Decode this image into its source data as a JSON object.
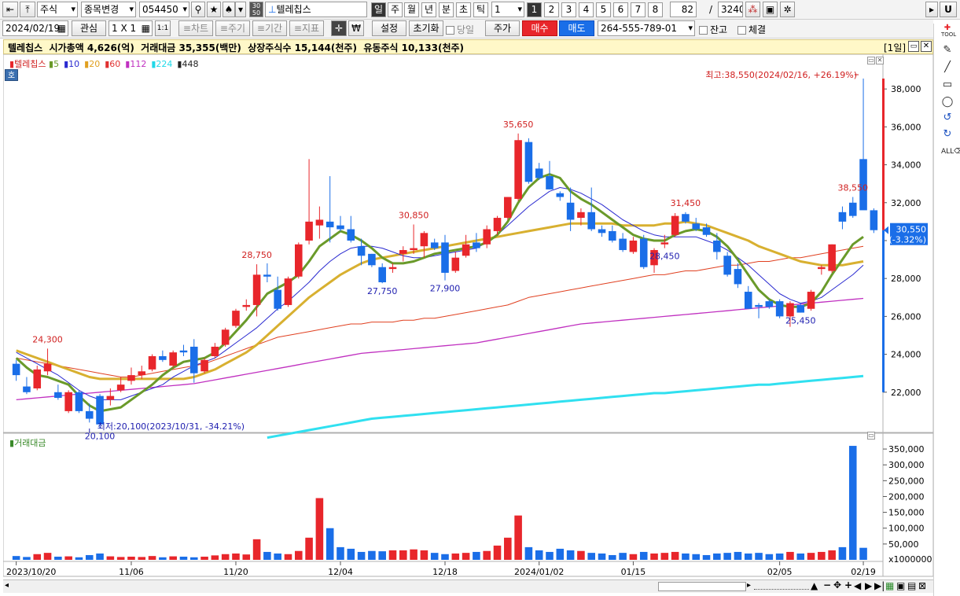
{
  "toolbar1": {
    "market": "주식",
    "change_item": "종목변경",
    "code": "054450",
    "chart_icon_top": "30",
    "chart_icon_bottom": "50",
    "stock_name": "텔레칩스",
    "periods": [
      "일",
      "주",
      "월",
      "년",
      "분",
      "초",
      "틱"
    ],
    "period_count": "1",
    "num_buttons": [
      "1",
      "2",
      "3",
      "4",
      "5",
      "6",
      "7",
      "8"
    ],
    "view_count": "82",
    "separator": "/",
    "total_count": "3240",
    "right_u": "U"
  },
  "toolbar2": {
    "date": "2024/02/19",
    "interest": "관심",
    "layout": "1 X 1",
    "one_one": "1:1",
    "tabs": [
      "≡차트",
      "≡주기",
      "≡기간",
      "≡지표"
    ],
    "currency_symbol": "₩",
    "settings": "설정",
    "reset": "초기화",
    "same_day": "당일",
    "price": "주가",
    "buy": "매수",
    "sell": "매도",
    "account": "264-555-789-01",
    "balance": "잔고",
    "executed": "체결"
  },
  "info_bar": {
    "text": "텔레칩스  시가총액 4,626(억)  거래대금 35,355(백만)  상장주식수 15,144(천주)  유동주식 10,133(천주)",
    "period_tag": "[1일]"
  },
  "legend": {
    "name": "텔레칩스",
    "items": [
      {
        "label": "5",
        "color": "#6a9a2a"
      },
      {
        "label": "10",
        "color": "#2a2ad0"
      },
      {
        "label": "20",
        "color": "#e0a020"
      },
      {
        "label": "60",
        "color": "#e03030"
      },
      {
        "label": "112",
        "color": "#c030c0"
      },
      {
        "label": "224",
        "color": "#20d8e8"
      },
      {
        "label": "448",
        "color": "#222222"
      }
    ],
    "badge": "호"
  },
  "annotations": {
    "max": "최고:38,550(2024/02/16, +26.19%)",
    "min": "최저:20,100(2023/10/31, -34.21%)",
    "current_price": "30,550",
    "current_change": "(-3.32%)",
    "peaks": [
      {
        "label": "24,300",
        "color": "#d02020",
        "idx": 3,
        "pos": "high"
      },
      {
        "label": "20,100",
        "color": "#2020b0",
        "idx": 8,
        "pos": "low"
      },
      {
        "label": "28,750",
        "color": "#d02020",
        "idx": 23,
        "pos": "high"
      },
      {
        "label": "27,750",
        "color": "#2020b0",
        "idx": 35,
        "pos": "low"
      },
      {
        "label": "30,850",
        "color": "#d02020",
        "idx": 38,
        "pos": "high"
      },
      {
        "label": "27,900",
        "color": "#2020b0",
        "idx": 41,
        "pos": "low"
      },
      {
        "label": "35,650",
        "color": "#d02020",
        "idx": 48,
        "pos": "high"
      },
      {
        "label": "31,450",
        "color": "#d02020",
        "idx": 64,
        "pos": "high"
      },
      {
        "label": "28,450",
        "color": "#2020b0",
        "idx": 62,
        "pos": "low"
      },
      {
        "label": "25,450",
        "color": "#2020b0",
        "idx": 75,
        "pos": "low"
      },
      {
        "label": "38,550",
        "color": "#d02020",
        "idx": 80,
        "pos": "high"
      }
    ]
  },
  "volume_panel": {
    "title": "거래대금",
    "unit": "x1000000"
  },
  "colors": {
    "up": "#e8262b",
    "down": "#1a6ee8",
    "ma5": "#6a9a2a",
    "ma10": "#2a2ad0",
    "ma20": "#d8b030",
    "ma60": "#e04020",
    "ma112": "#c030c0",
    "ma224": "#30e0f0"
  },
  "chart_data": {
    "type": "candlestick",
    "price_axis": {
      "ticks": [
        "38,000",
        "36,000",
        "34,000",
        "32,000",
        "30,000",
        "28,000",
        "26,000",
        "24,000",
        "22,000"
      ],
      "ylim": [
        20000,
        39500
      ]
    },
    "volume_axis": {
      "ticks": [
        "350,000",
        "300,000",
        "250,000",
        "200,000",
        "150,000",
        "100,000",
        "50,000"
      ],
      "ylim": [
        0,
        380000
      ]
    },
    "x_labels": [
      {
        "label": "2023/10/20",
        "idx": 0
      },
      {
        "label": "11/06",
        "idx": 11
      },
      {
        "label": "11/20",
        "idx": 21
      },
      {
        "label": "12/04",
        "idx": 31
      },
      {
        "label": "12/18",
        "idx": 41
      },
      {
        "label": "2024/01/02",
        "idx": 50
      },
      {
        "label": "01/15",
        "idx": 59
      },
      {
        "label": "02/05",
        "idx": 73
      },
      {
        "label": "02/19",
        "idx": 81
      }
    ],
    "candles": [
      [
        23500,
        23700,
        22600,
        22900
      ],
      [
        22300,
        22800,
        21900,
        22000
      ],
      [
        22200,
        23400,
        22100,
        23200
      ],
      [
        23100,
        24300,
        22900,
        23500
      ],
      [
        22000,
        22400,
        21600,
        21700
      ],
      [
        21000,
        22100,
        20900,
        22000
      ],
      [
        22000,
        22100,
        20900,
        21000
      ],
      [
        21000,
        21400,
        20400,
        20600
      ],
      [
        21800,
        21900,
        20100,
        20300
      ],
      [
        21600,
        22200,
        21300,
        21800
      ],
      [
        22100,
        22800,
        22000,
        22400
      ],
      [
        22600,
        23300,
        22400,
        22900
      ],
      [
        22900,
        23400,
        22700,
        23100
      ],
      [
        23200,
        24000,
        23100,
        23900
      ],
      [
        23900,
        24200,
        23600,
        23700
      ],
      [
        23400,
        24200,
        23300,
        24100
      ],
      [
        24200,
        24500,
        23900,
        24100
      ],
      [
        24400,
        24800,
        22500,
        23000
      ],
      [
        23100,
        23800,
        23000,
        23700
      ],
      [
        23900,
        24600,
        23800,
        24400
      ],
      [
        24500,
        25400,
        24400,
        25300
      ],
      [
        25500,
        26400,
        25400,
        26300
      ],
      [
        26500,
        26900,
        26300,
        26600
      ],
      [
        26600,
        28750,
        26000,
        28200
      ],
      [
        28200,
        28800,
        27800,
        28100
      ],
      [
        27400,
        28100,
        26300,
        26400
      ],
      [
        26600,
        28100,
        26500,
        28000
      ],
      [
        28100,
        29900,
        28000,
        29800
      ],
      [
        30000,
        34300,
        29800,
        31000
      ],
      [
        30800,
        31800,
        30100,
        31100
      ],
      [
        31000,
        33400,
        29900,
        30700
      ],
      [
        30800,
        31300,
        30500,
        30600
      ],
      [
        30600,
        31300,
        29900,
        30000
      ],
      [
        29700,
        30100,
        28700,
        29200
      ],
      [
        29300,
        29300,
        28600,
        28700
      ],
      [
        28600,
        28800,
        27750,
        27800
      ],
      [
        28500,
        28800,
        28300,
        28600
      ],
      [
        29300,
        29700,
        28900,
        29500
      ],
      [
        29500,
        30850,
        29300,
        29600
      ],
      [
        29700,
        30500,
        29100,
        30400
      ],
      [
        29900,
        30100,
        29500,
        29600
      ],
      [
        29900,
        30300,
        27900,
        28300
      ],
      [
        28400,
        29400,
        28300,
        29100
      ],
      [
        29200,
        30300,
        29100,
        29800
      ],
      [
        29900,
        30400,
        29400,
        29600
      ],
      [
        29800,
        30800,
        29600,
        30600
      ],
      [
        30500,
        31300,
        30300,
        31200
      ],
      [
        31200,
        32300,
        31100,
        32300
      ],
      [
        32200,
        35650,
        32100,
        35300
      ],
      [
        35200,
        35400,
        33000,
        33100
      ],
      [
        33800,
        34100,
        33200,
        33300
      ],
      [
        33400,
        34200,
        32700,
        32700
      ],
      [
        32500,
        32600,
        32100,
        32300
      ],
      [
        32000,
        32800,
        30500,
        31100
      ],
      [
        31200,
        31700,
        30800,
        31500
      ],
      [
        31500,
        32800,
        30500,
        30600
      ],
      [
        30600,
        30800,
        30200,
        30400
      ],
      [
        30500,
        30800,
        29900,
        30000
      ],
      [
        30100,
        30400,
        29400,
        29500
      ],
      [
        29400,
        30200,
        29300,
        30000
      ],
      [
        30100,
        30300,
        28500,
        28600
      ],
      [
        28700,
        29600,
        28300,
        29500
      ],
      [
        29800,
        30300,
        29600,
        29900
      ],
      [
        30300,
        31450,
        30200,
        31300
      ],
      [
        31400,
        31500,
        30900,
        31000
      ],
      [
        30900,
        31200,
        30500,
        30600
      ],
      [
        30700,
        30900,
        30200,
        30300
      ],
      [
        30000,
        30400,
        29000,
        29400
      ],
      [
        29200,
        29400,
        28100,
        28200
      ],
      [
        28500,
        28800,
        27500,
        27700
      ],
      [
        27300,
        27600,
        26400,
        26400
      ],
      [
        26600,
        26700,
        25900,
        26500
      ],
      [
        26800,
        26900,
        26400,
        26500
      ],
      [
        26800,
        26900,
        25900,
        26000
      ],
      [
        26000,
        26800,
        25450,
        26700
      ],
      [
        26600,
        26700,
        26200,
        26200
      ],
      [
        26400,
        27400,
        26300,
        27300
      ],
      [
        28500,
        28700,
        28200,
        28600
      ],
      [
        28400,
        29800,
        28300,
        29800
      ],
      [
        31500,
        31800,
        30600,
        31000
      ],
      [
        32000,
        32300,
        31200,
        31300
      ],
      [
        34300,
        38550,
        31700,
        31600
      ],
      [
        31600,
        31700,
        30400,
        30550
      ]
    ],
    "volume": [
      12000,
      9000,
      18000,
      22000,
      10000,
      11000,
      8000,
      15000,
      20000,
      11000,
      9000,
      10000,
      9000,
      12000,
      8000,
      11000,
      10000,
      8000,
      10000,
      14000,
      18000,
      20000,
      17000,
      65000,
      25000,
      20000,
      18000,
      28000,
      70000,
      195000,
      100000,
      40000,
      35000,
      25000,
      28000,
      27000,
      30000,
      30000,
      33000,
      30000,
      22000,
      18000,
      20000,
      22000,
      25000,
      28000,
      45000,
      70000,
      140000,
      40000,
      30000,
      25000,
      35000,
      30000,
      28000,
      22000,
      20000,
      15000,
      22000,
      18000,
      25000,
      20000,
      22000,
      25000,
      20000,
      18000,
      15000,
      20000,
      22000,
      25000,
      20000,
      22000,
      18000,
      20000,
      25000,
      20000,
      22000,
      25000,
      30000,
      40000,
      360000,
      38000
    ],
    "ma_lines": {
      "ma5": [
        23800,
        23300,
        22900,
        22800,
        22600,
        22400,
        21800,
        21300,
        21000,
        21100,
        21200,
        21600,
        22000,
        22400,
        22900,
        23300,
        23600,
        23700,
        23800,
        24100,
        24600,
        25200,
        25800,
        26500,
        27200,
        27500,
        27800,
        28200,
        28900,
        29700,
        30100,
        30500,
        30300,
        30000,
        29600,
        29100,
        28800,
        28800,
        28900,
        29100,
        29300,
        29400,
        29500,
        29600,
        29700,
        29900,
        30300,
        31000,
        32000,
        32800,
        33300,
        33500,
        33300,
        32600,
        32200,
        31900,
        31500,
        31100,
        30700,
        30300,
        30100,
        30000,
        30000,
        30300,
        30500,
        30600,
        30500,
        30200,
        29700,
        29000,
        28200,
        27400,
        26900,
        26600,
        26500,
        26500,
        26700,
        27300,
        28200,
        29000,
        29800,
        30200
      ],
      "ma10": [
        24100,
        23800,
        23500,
        23200,
        22900,
        22500,
        22100,
        21800,
        21600,
        21600,
        21600,
        21800,
        22000,
        22200,
        22400,
        22800,
        23100,
        23400,
        23600,
        23800,
        24200,
        24600,
        25000,
        25400,
        25900,
        26400,
        26800,
        27300,
        27800,
        28400,
        28900,
        29300,
        29600,
        29700,
        29700,
        29600,
        29400,
        29200,
        29100,
        29100,
        29200,
        29300,
        29400,
        29500,
        29600,
        29900,
        30300,
        30800,
        31300,
        31800,
        32200,
        32600,
        32800,
        32700,
        32500,
        32200,
        31900,
        31500,
        31100,
        30800,
        30500,
        30300,
        30200,
        30200,
        30200,
        30200,
        30000,
        29800,
        29500,
        29100,
        28700,
        28200,
        27700,
        27200,
        26900,
        26700,
        26800,
        27000,
        27400,
        27800,
        28200,
        28700
      ],
      "ma20": [
        24200,
        24000,
        23800,
        23600,
        23400,
        23200,
        23000,
        22800,
        22700,
        22700,
        22700,
        22700,
        22700,
        22700,
        22700,
        22700,
        22700,
        22800,
        23000,
        23200,
        23500,
        23800,
        24100,
        24500,
        25000,
        25500,
        26000,
        26500,
        27000,
        27400,
        27800,
        28200,
        28500,
        28800,
        29000,
        29100,
        29200,
        29300,
        29400,
        29500,
        29600,
        29700,
        29800,
        29900,
        30000,
        30100,
        30200,
        30300,
        30400,
        30500,
        30600,
        30700,
        30800,
        30900,
        30900,
        30900,
        30900,
        30900,
        30800,
        30800,
        30800,
        30800,
        30900,
        30900,
        31000,
        30900,
        30800,
        30600,
        30400,
        30200,
        30000,
        29700,
        29500,
        29300,
        29100,
        28900,
        28800,
        28700,
        28700,
        28700,
        28800,
        28900
      ],
      "ma60": [
        23800,
        23700,
        23600,
        23500,
        23400,
        23300,
        23200,
        23100,
        23000,
        22900,
        22800,
        22800,
        22900,
        23000,
        23100,
        23200,
        23300,
        23400,
        23500,
        23700,
        23900,
        24100,
        24300,
        24500,
        24700,
        24900,
        25000,
        25100,
        25200,
        25300,
        25400,
        25500,
        25600,
        25600,
        25700,
        25700,
        25700,
        25800,
        25800,
        25900,
        25900,
        26000,
        26100,
        26200,
        26300,
        26400,
        26500,
        26600,
        26800,
        27000,
        27100,
        27200,
        27300,
        27400,
        27500,
        27600,
        27700,
        27800,
        27900,
        28000,
        28100,
        28200,
        28200,
        28300,
        28400,
        28400,
        28500,
        28600,
        28700,
        28700,
        28800,
        28900,
        28900,
        29000,
        29100,
        29100,
        29200,
        29300,
        29400,
        29500,
        29600,
        29700
      ],
      "ma112": [
        21600,
        21650,
        21700,
        21750,
        21800,
        21850,
        21900,
        21950,
        22000,
        22050,
        22100,
        22150,
        22200,
        22250,
        22300,
        22350,
        22400,
        22450,
        22550,
        22650,
        22750,
        22850,
        22950,
        23050,
        23150,
        23250,
        23350,
        23450,
        23550,
        23650,
        23750,
        23850,
        23950,
        24050,
        24100,
        24150,
        24200,
        24250,
        24300,
        24350,
        24400,
        24450,
        24500,
        24550,
        24600,
        24700,
        24800,
        24900,
        25000,
        25100,
        25200,
        25300,
        25400,
        25500,
        25600,
        25650,
        25700,
        25750,
        25800,
        25850,
        25900,
        25950,
        26000,
        26050,
        26100,
        26150,
        26200,
        26250,
        26300,
        26350,
        26400,
        26450,
        26500,
        26550,
        26600,
        26650,
        26700,
        26750,
        26800,
        26850,
        26900,
        26950
      ],
      "ma224": [
        null,
        null,
        null,
        null,
        null,
        null,
        null,
        null,
        null,
        null,
        null,
        null,
        null,
        null,
        null,
        null,
        null,
        null,
        null,
        null,
        null,
        null,
        null,
        null,
        19600,
        19700,
        19800,
        19900,
        20000,
        20100,
        20200,
        20300,
        20400,
        20500,
        20600,
        20650,
        20700,
        20750,
        20800,
        20850,
        20900,
        20950,
        21000,
        21050,
        21100,
        21150,
        21200,
        21250,
        21300,
        21350,
        21400,
        21450,
        21500,
        21550,
        21600,
        21650,
        21700,
        21750,
        21800,
        21850,
        21900,
        21950,
        21950,
        22000,
        22050,
        22100,
        22150,
        22200,
        22250,
        22300,
        22350,
        22400,
        22400,
        22450,
        22500,
        22550,
        22600,
        22650,
        22700,
        22750,
        22800,
        22850
      ]
    }
  }
}
